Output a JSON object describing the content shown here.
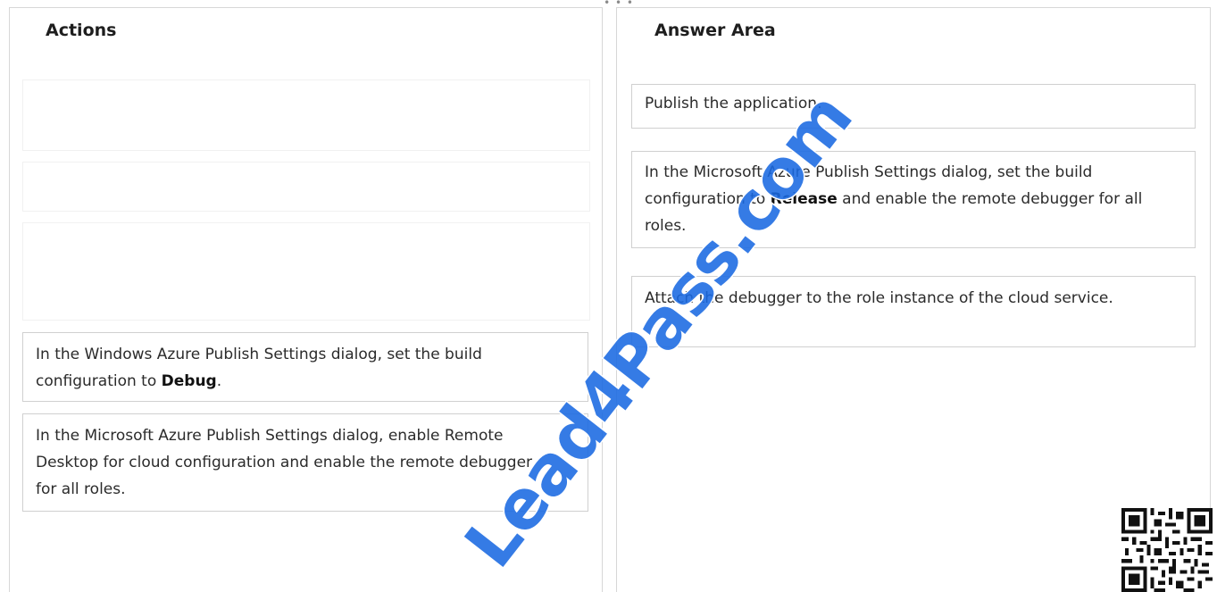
{
  "panels": {
    "actions_title": "Actions",
    "answer_title": "Answer Area"
  },
  "actions": [
    {
      "before": "In the Windows Azure Publish Settings dialog, set the build configuration to ",
      "bold": "Debug",
      "after": "."
    },
    {
      "before": "In the Microsoft Azure Publish Settings dialog, enable Remote Desktop for cloud configuration and enable the remote debugger for all roles.",
      "bold": "",
      "after": ""
    }
  ],
  "answers": [
    {
      "before": "Publish the application.",
      "bold": "",
      "after": ""
    },
    {
      "before": "In the Microsoft Azure Publish Settings dialog, set the build configuration to ",
      "bold": "Release",
      "after": " and enable the remote debugger for all roles."
    },
    {
      "before": "Attach the debugger to the role instance of the cloud service.",
      "bold": "",
      "after": ""
    }
  ],
  "watermark": "Lead4Pass.com",
  "colors": {
    "watermark": "#1969e1",
    "border": "#d0d0d0",
    "text": "#2b2b2b"
  },
  "icons": {
    "drag_handle": "ellipsis-icon",
    "qr": "qr-code-icon"
  }
}
